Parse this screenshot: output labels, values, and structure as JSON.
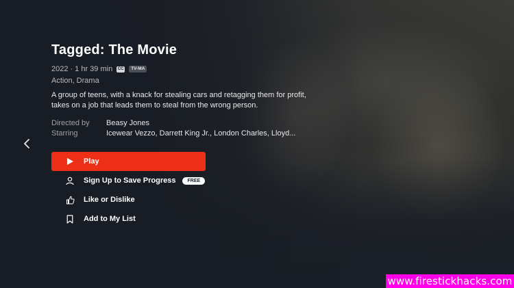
{
  "movie": {
    "title": "Tagged: The Movie",
    "year": "2022",
    "duration": "1 hr 39 min",
    "cc_badge": "CC",
    "rating_badge": "TV-MA",
    "genres": "Action, Drama",
    "description": "A group of teens, with a knack for stealing cars and retagging them for profit, takes on a job that leads them to steal from the wrong person.",
    "directed_by_label": "Directed by",
    "director": "Beasy Jones",
    "starring_label": "Starring",
    "cast": "Icewear Vezzo, Darrett King Jr., London Charles, Lloyd..."
  },
  "actions": {
    "play": "Play",
    "sign_up": "Sign Up to Save Progress",
    "free_badge": "FREE",
    "like": "Like or Dislike",
    "my_list": "Add to My List"
  },
  "watermark": "www.firestickhacks.com",
  "colors": {
    "accent": "#ee2f17",
    "background": "#1c2129",
    "watermark": "#ff00e8"
  },
  "icons": [
    "chevron-left-icon",
    "play-icon",
    "user-icon",
    "thumbs-up-icon",
    "bookmark-icon"
  ]
}
